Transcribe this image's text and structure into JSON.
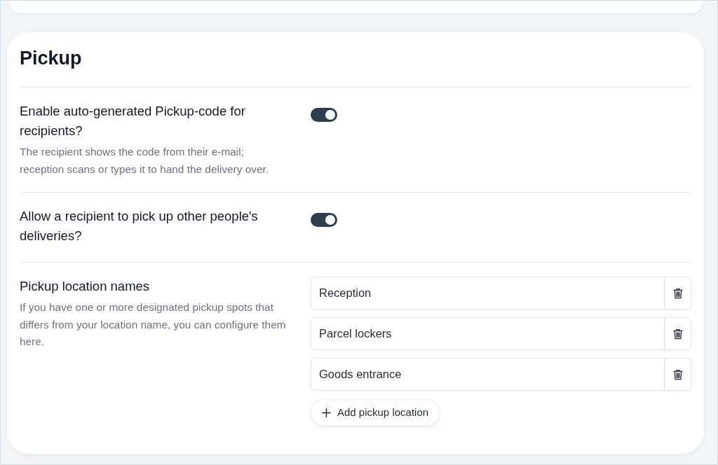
{
  "section": {
    "title": "Pickup"
  },
  "settings": [
    {
      "kind": "toggle",
      "label": "Enable auto-generated Pickup-code for recipients?",
      "description": "The recipient shows the code from their e-mail; reception scans or types it to hand the delivery over.",
      "on": true
    },
    {
      "kind": "toggle",
      "label": "Allow a recipient to pick up other people's deliveries?",
      "on": true
    },
    {
      "kind": "list",
      "label": "Pickup location names",
      "description": "If you have one or more designated pickup spots that differs from your location name, you can configure them here.",
      "locations": [
        {
          "value": "Reception"
        },
        {
          "value": "Parcel lockers"
        },
        {
          "value": "Goods entrance"
        }
      ],
      "add_button": "Add pickup location"
    }
  ]
}
